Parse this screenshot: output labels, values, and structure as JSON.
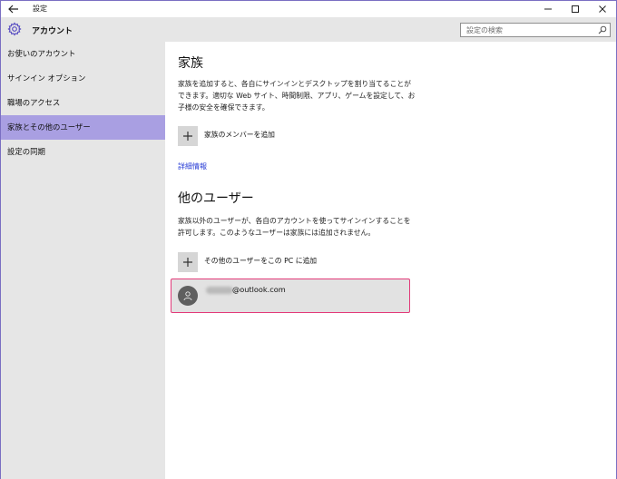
{
  "window": {
    "title": "設定",
    "back_icon": "arrow-left-icon",
    "minimize_icon": "minimize-icon",
    "maximize_icon": "maximize-icon",
    "close_icon": "close-icon"
  },
  "app": {
    "title": "アカウント",
    "icon": "gear-icon",
    "accent_color": "#a99fe2"
  },
  "search": {
    "placeholder": "設定の検索",
    "icon": "search-icon"
  },
  "sidebar": {
    "items": [
      {
        "label": "お使いのアカウント",
        "selected": false
      },
      {
        "label": "サインイン オプション",
        "selected": false
      },
      {
        "label": "職場のアクセス",
        "selected": false
      },
      {
        "label": "家族とその他のユーザー",
        "selected": true
      },
      {
        "label": "設定の同期",
        "selected": false
      }
    ]
  },
  "family": {
    "heading": "家族",
    "description": "家族を追加すると、各自にサインインとデスクトップを割り当てることができます。適切な Web サイト、時間制限、アプリ、ゲームを設定して、お子様の安全を確保できます。",
    "add_label": "家族のメンバーを追加",
    "link": "詳細情報"
  },
  "other_users": {
    "heading": "他のユーザー",
    "description": "家族以外のユーザーが、各自のアカウントを使ってサインインすることを許可します。このようなユーザーは家族には追加されません。",
    "add_label": "その他のユーザーをこの PC に追加",
    "account_domain": "@outlook.com",
    "highlight_color": "#e23a79"
  }
}
